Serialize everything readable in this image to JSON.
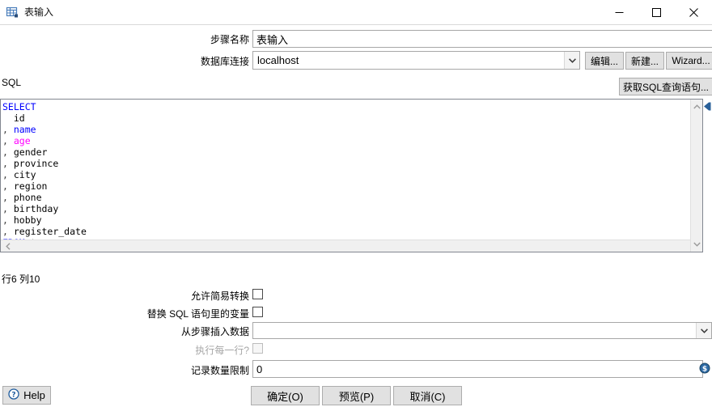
{
  "window": {
    "title": "表输入",
    "icon": "table-input-icon",
    "controls": {
      "minimize": "minimize-icon",
      "maximize": "maximize-icon",
      "close": "close-icon"
    }
  },
  "form": {
    "step_name_label": "步骤名称",
    "step_name_value": "表输入",
    "connection_label": "数据库连接",
    "connection_value": "localhost",
    "connection_options": [
      "localhost"
    ],
    "edit_button": "编辑...",
    "new_button": "新建...",
    "wizard_button": "Wizard...",
    "get_sql_button": "获取SQL查询语句..."
  },
  "sql": {
    "section_label": "SQL",
    "lines": [
      {
        "indent": 0,
        "prefix": "",
        "keyword": "SELECT",
        "body": ""
      },
      {
        "indent": 2,
        "prefix": "",
        "keyword": "",
        "body": "id"
      },
      {
        "indent": 0,
        "prefix": ",",
        "keyword": "",
        "body": "name",
        "color": "blue"
      },
      {
        "indent": 0,
        "prefix": ",",
        "keyword": "",
        "body": "age",
        "color": "magenta"
      },
      {
        "indent": 0,
        "prefix": ",",
        "keyword": "",
        "body": "gender"
      },
      {
        "indent": 0,
        "prefix": ",",
        "keyword": "",
        "body": "province"
      },
      {
        "indent": 0,
        "prefix": ",",
        "keyword": "",
        "body": "city"
      },
      {
        "indent": 0,
        "prefix": ",",
        "keyword": "",
        "body": "region"
      },
      {
        "indent": 0,
        "prefix": ",",
        "keyword": "",
        "body": "phone"
      },
      {
        "indent": 0,
        "prefix": ",",
        "keyword": "",
        "body": "birthday"
      },
      {
        "indent": 0,
        "prefix": ",",
        "keyword": "",
        "body": "hobby"
      },
      {
        "indent": 0,
        "prefix": ",",
        "keyword": "",
        "body": "register_date"
      },
      {
        "indent": 0,
        "prefix": "",
        "keyword": "FROM",
        "body": " t_user"
      }
    ],
    "raw": "SELECT\n  id\n, name\n, age\n, gender\n, province\n, city\n, region\n, phone\n, birthday\n, hobby\n, register_date\nFROM t_user",
    "caret_status": "行6 列10"
  },
  "options": {
    "lazy_conversion_label": "允许简易转换",
    "lazy_conversion_checked": false,
    "replace_vars_label": "替换 SQL 语句里的变量",
    "replace_vars_checked": false,
    "insert_from_step_label": "从步骤插入数据",
    "insert_from_step_value": "",
    "execute_each_row_label": "执行每一行?",
    "execute_each_row_checked": false,
    "execute_each_row_disabled": true,
    "row_limit_label": "记录数量限制",
    "row_limit_value": "0"
  },
  "footer": {
    "help_label": "Help",
    "ok_label": "确定(O)",
    "preview_label": "预览(P)",
    "cancel_label": "取消(C)"
  },
  "colors": {
    "keyword_blue": "#0000ff",
    "magenta": "#ff00ff",
    "accent_blue": "#2a6099",
    "button_face": "#e1e1e1",
    "border": "#a7a7a7"
  }
}
